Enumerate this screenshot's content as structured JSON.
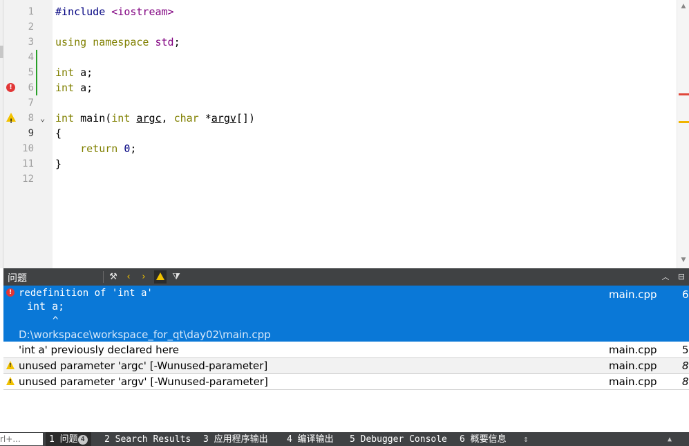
{
  "editor": {
    "line_numbers": [
      "1",
      "2",
      "3",
      "4",
      "5",
      "6",
      "7",
      "8",
      "9",
      "10",
      "11",
      "12"
    ],
    "lines": [
      {
        "n": "1",
        "tokens": [
          {
            "t": "#include",
            "c": "pp"
          },
          {
            "t": " "
          },
          {
            "t": "<iostream>",
            "c": "ns"
          }
        ]
      },
      {
        "n": "2",
        "tokens": []
      },
      {
        "n": "3",
        "tokens": [
          {
            "t": "using",
            "c": "kw"
          },
          {
            "t": " "
          },
          {
            "t": "namespace",
            "c": "kw"
          },
          {
            "t": " "
          },
          {
            "t": "std",
            "c": "ns"
          },
          {
            "t": ";"
          }
        ]
      },
      {
        "n": "4",
        "tokens": []
      },
      {
        "n": "5",
        "tokens": [
          {
            "t": "int",
            "c": "kw"
          },
          {
            "t": " a;"
          }
        ]
      },
      {
        "n": "6",
        "tokens": [
          {
            "t": "int",
            "c": "kw"
          },
          {
            "t": " a;"
          }
        ]
      },
      {
        "n": "7",
        "tokens": []
      },
      {
        "n": "8",
        "tokens": [
          {
            "t": "int",
            "c": "kw"
          },
          {
            "t": " main("
          },
          {
            "t": "int",
            "c": "kw"
          },
          {
            "t": " "
          },
          {
            "t": "argc",
            "c": "ul"
          },
          {
            "t": ", "
          },
          {
            "t": "char",
            "c": "kw"
          },
          {
            "t": " *"
          },
          {
            "t": "argv",
            "c": "ul"
          },
          {
            "t": "[])"
          }
        ]
      },
      {
        "n": "9",
        "tokens": [
          {
            "t": "{"
          }
        ]
      },
      {
        "n": "10",
        "tokens": [
          {
            "t": "    "
          },
          {
            "t": "return",
            "c": "kw"
          },
          {
            "t": " "
          },
          {
            "t": "0",
            "c": "nm"
          },
          {
            "t": ";"
          }
        ]
      },
      {
        "n": "11",
        "tokens": [
          {
            "t": "}"
          }
        ]
      },
      {
        "n": "12",
        "tokens": []
      }
    ],
    "error_line": "6",
    "warning_line": "8",
    "fold_marker": "⌄",
    "scrollbar_marks": [
      {
        "kind": "error",
        "color": "#e0473a"
      },
      {
        "kind": "warning",
        "color": "#f0b400"
      }
    ]
  },
  "issues": {
    "title": "问题",
    "toolbar_icons": [
      "build-icon",
      "previous-icon",
      "next-icon",
      "warning-filter-icon",
      "filter-icon"
    ],
    "header_icons": [
      "collapse-up-icon",
      "maximize-icon"
    ],
    "selected": {
      "type": "error",
      "message": "redefinition of 'int a'",
      "snippet": "int a;",
      "caret": "^",
      "path": "D:\\workspace\\workspace_for_qt\\day02\\main.cpp",
      "file": "main.cpp",
      "line": "6"
    },
    "rows": [
      {
        "type": "note",
        "message": "'int a' previously declared here",
        "file": "main.cpp",
        "line": "5"
      },
      {
        "type": "warning",
        "message": "unused parameter 'argc' [-Wunused-parameter]",
        "file": "main.cpp",
        "line": "8"
      },
      {
        "type": "warning",
        "message": "unused parameter 'argv' [-Wunused-parameter]",
        "file": "main.cpp",
        "line": "8"
      }
    ]
  },
  "bottom_bar": {
    "locator_text": "rl+...",
    "tabs": [
      {
        "num": "1",
        "label": "问题",
        "badge": "4",
        "active": true
      },
      {
        "num": "2",
        "label": "Search Results"
      },
      {
        "num": "3",
        "label": "应用程序输出"
      },
      {
        "num": "4",
        "label": "编译输出"
      },
      {
        "num": "5",
        "label": "Debugger Console"
      },
      {
        "num": "6",
        "label": "概要信息"
      }
    ],
    "more_icon": "⇕",
    "up_icon": "▲"
  }
}
